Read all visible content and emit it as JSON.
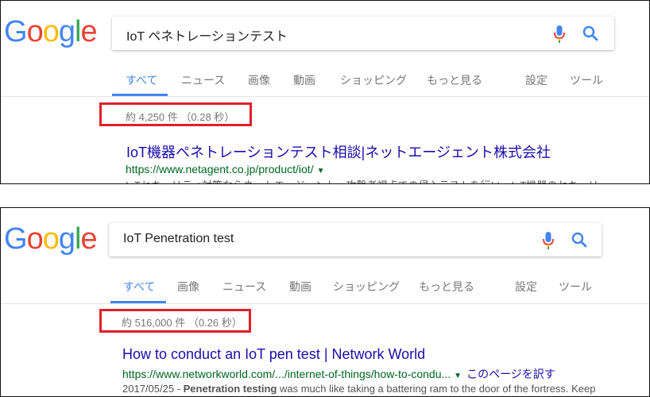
{
  "panel1": {
    "logo": [
      "G",
      "o",
      "o",
      "g",
      "l",
      "e"
    ],
    "search": {
      "query": "IoT ペネトレーションテスト"
    },
    "tabs": [
      "すべて",
      "ニュース",
      "画像",
      "動画",
      "ショッピング",
      "もっと見る",
      "設定",
      "ツール"
    ],
    "stats": "約 4,250 件 （0.28 秒）",
    "result": {
      "title": "IoT機器ペネトレーションテスト相談|ネットエージェント株式会社",
      "url": "https://www.netagent.co.jp/product/iot/",
      "snippet": "IoTセキュリティ対策ならネットエージェント。攻撃者視点での侵入テストを行い、IoT機器のセキュリ"
    }
  },
  "panel2": {
    "logo": [
      "G",
      "o",
      "o",
      "g",
      "l",
      "e"
    ],
    "search": {
      "query": "IoT Penetration test"
    },
    "tabs": [
      "すべて",
      "画像",
      "ニュース",
      "動画",
      "ショッピング",
      "もっと見る",
      "設定",
      "ツール"
    ],
    "stats": "約 516,000 件 （0.26 秒）",
    "result": {
      "title": "How to conduct an IoT pen test | Network World",
      "url": "https://www.networkworld.com/.../internet-of-things/how-to-condu...",
      "translate": "このページを訳す",
      "date": "2017/05/25",
      "snippet_bold": "Penetration testing",
      "snippet_rest": " was much like taking a battering ram to the door of the fortress. Keep"
    }
  },
  "colors": {
    "blue": "#4285f4",
    "red": "#ea4335",
    "yellow": "#fbbc05",
    "green": "#34a853",
    "highlight": "#e0202a",
    "link": "#1a0dab",
    "url": "#006621"
  }
}
